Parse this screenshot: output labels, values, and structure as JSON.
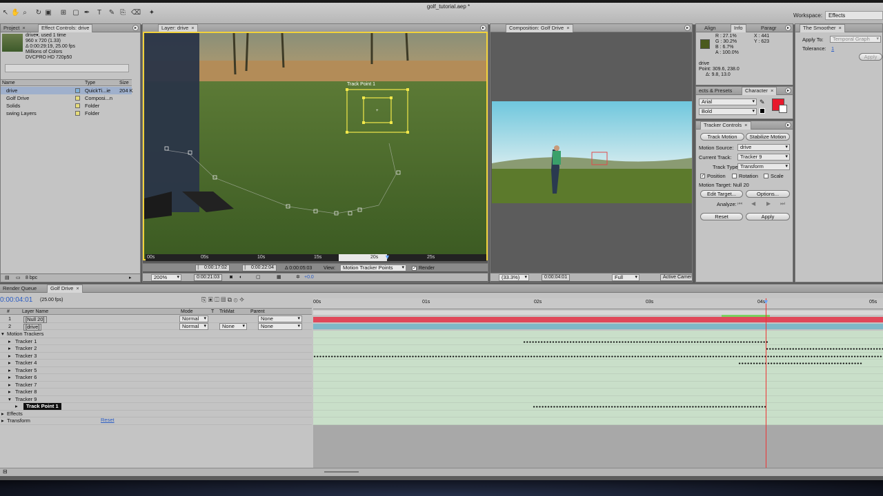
{
  "app": {
    "document_title": "golf_tutorial.aep *",
    "workspace_label": "Workspace:",
    "workspace_value": "Effects"
  },
  "project": {
    "tabs": [
      "Project",
      "Effect Controls: drive"
    ],
    "info": [
      "drive▾, used 1 time",
      "960 x 720 (1.33)",
      "Δ 0:00:29:19, 25.00 fps",
      "Millions of Colors",
      "DVCPRO HD 720p50"
    ],
    "columns": [
      "Name",
      "Type",
      "Size"
    ],
    "items": [
      {
        "name": "drive",
        "type": "QuickTi...ie",
        "size": "204 K",
        "color": "#7fb0d8",
        "selected": true
      },
      {
        "name": "Golf Drive",
        "type": "Composi...n",
        "size": "",
        "color": "#e6dc7a",
        "selected": false
      },
      {
        "name": "Solids",
        "type": "Folder",
        "size": "",
        "color": "#e6dc7a",
        "selected": false
      },
      {
        "name": "swing Layers",
        "type": "Folder",
        "size": "",
        "color": "#e6dc7a",
        "selected": false
      }
    ],
    "bpc": "8 bpc"
  },
  "layer_viewer": {
    "tab": "Layer: drive",
    "track_point_label": "Track Point 1",
    "ruler_labels": [
      "00s",
      "05s",
      "10s",
      "15s",
      "20s",
      "25s"
    ],
    "in_time": "0:00:17:02",
    "out_time": "0:00:22:04",
    "duration": "Δ 0:00:05:03",
    "view_label": "View:",
    "view_value": "Motion Tracker Points",
    "render_label": "Render",
    "zoom": "200%",
    "current_time": "0:00:21:03",
    "exposure": "+0.0"
  },
  "comp_viewer": {
    "tab": "Composition: Golf Drive",
    "zoom": "(33.3%)",
    "current_time": "0:00:04:01",
    "resolution": "Full",
    "camera": "Active Camera"
  },
  "info_panel": {
    "tabs": [
      "Align",
      "Info",
      "Paragr"
    ],
    "r": "R : 27.1%",
    "g": "G : 30.2%",
    "b": "B : 6.7%",
    "a": "A : 100.0%",
    "x": "X : 441",
    "y": "Y : 623",
    "swatch_color": "#4b5a1e",
    "layer": "drive",
    "point": "Point: 309.6, 238.0",
    "delta": "Δ: 9.8, 13.0"
  },
  "smoother": {
    "tab": "The Smoother",
    "apply_to_label": "Apply To:",
    "apply_to_value": "Temporal Graph",
    "tolerance_label": "Tolerance:",
    "tolerance_value": "1",
    "apply": "Apply"
  },
  "character": {
    "tabs": [
      "ects & Presets",
      "Character"
    ],
    "font": "Arial",
    "style": "Bold",
    "fill_color": "#e8192c"
  },
  "tracker": {
    "tab": "Tracker Controls",
    "track_motion": "Track Motion",
    "stabilize_motion": "Stabilize Motion",
    "motion_source_label": "Motion Source:",
    "motion_source": "drive",
    "current_track_label": "Current Track:",
    "current_track": "Tracker 9",
    "track_type_label": "Track Type:",
    "track_type": "Transform",
    "position": "Position",
    "rotation": "Rotation",
    "scale": "Scale",
    "motion_target": "Motion Target: Null 20",
    "edit_target": "Edit Target...",
    "options": "Options...",
    "analyze_label": "Analyze:",
    "reset": "Reset",
    "apply": "Apply"
  },
  "timeline": {
    "tabs": [
      "Render Queue",
      "Golf Drive"
    ],
    "current_time": "0:00:04:01",
    "fps": "(25.00 fps)",
    "columns": {
      "num": "#",
      "layer_name": "Layer Name",
      "mode": "Mode",
      "t": "T",
      "trkmat": "TrkMat",
      "parent": "Parent"
    },
    "ruler_labels": [
      "00s",
      "01s",
      "02s",
      "03s",
      "04s",
      "05s"
    ],
    "layers": [
      {
        "num": "1",
        "name": "[Null 20]",
        "mode": "Normal",
        "trkmat": "",
        "parent": "None"
      },
      {
        "num": "2",
        "name": "[drive]",
        "mode": "Normal",
        "trkmat": "None",
        "parent": "None"
      }
    ],
    "tree": [
      {
        "label": "Motion Trackers",
        "indent": 0,
        "twirl": "▾"
      },
      {
        "label": "Tracker 1",
        "indent": 1,
        "twirl": "▸"
      },
      {
        "label": "Tracker 2",
        "indent": 1,
        "twirl": "▸"
      },
      {
        "label": "Tracker 3",
        "indent": 1,
        "twirl": "▸"
      },
      {
        "label": "Tracker 4",
        "indent": 1,
        "twirl": "▸"
      },
      {
        "label": "Tracker 5",
        "indent": 1,
        "twirl": "▸"
      },
      {
        "label": "Tracker 6",
        "indent": 1,
        "twirl": "▸"
      },
      {
        "label": "Tracker 7",
        "indent": 1,
        "twirl": "▸"
      },
      {
        "label": "Tracker 8",
        "indent": 1,
        "twirl": "▸"
      },
      {
        "label": "Tracker 9",
        "indent": 1,
        "twirl": "▾"
      },
      {
        "label": "Track Point 1",
        "indent": 2,
        "twirl": "▸"
      },
      {
        "label": "Effects",
        "indent": 0,
        "twirl": "▸"
      },
      {
        "label": "Transform",
        "indent": 0,
        "twirl": "▸"
      }
    ],
    "reset_label": "Reset"
  }
}
